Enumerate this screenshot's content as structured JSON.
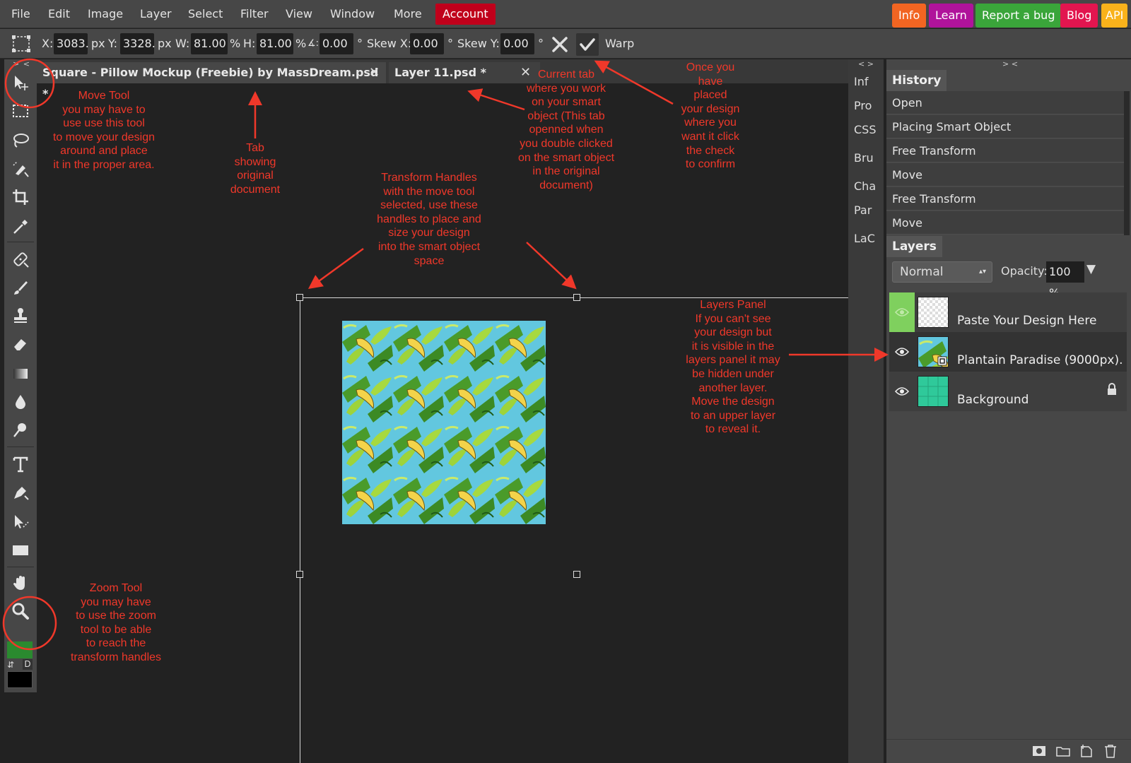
{
  "menu": {
    "items": [
      "File",
      "Edit",
      "Image",
      "Layer",
      "Select",
      "Filter",
      "View",
      "Window",
      "More"
    ],
    "account": "Account",
    "external": [
      "Info",
      "Learn",
      "Report a bug",
      "Blog",
      "API"
    ]
  },
  "options": {
    "x_label": "X:",
    "x_value": "3083.",
    "x_unit": "px",
    "y_label": "Y:",
    "y_value": "3328.",
    "y_unit": "px",
    "w_label": "W:",
    "w_value": "81.00",
    "w_unit": "%",
    "h_label": "H:",
    "h_value": "81.00",
    "h_unit": "%",
    "angle_label": "∡:",
    "angle_value": "0.00",
    "angle_unit": "°",
    "skewx_label": "Skew X:",
    "skewx_value": "0.00",
    "skewx_unit": "°",
    "skewy_label": "Skew Y:",
    "skewy_value": "0.00",
    "skewy_unit": "°",
    "warp_label": "Warp"
  },
  "toolbar": {
    "collapse": "> <",
    "swap": "⇵",
    "default_colors": "D",
    "fg_color": "#2a8a2f",
    "bg_color": "#000000"
  },
  "tabs": [
    {
      "label": "Square - Pillow Mockup (Freebie) by MassDream.psd *",
      "close": "✕"
    },
    {
      "label": "Layer 11.psd *",
      "close": "✕"
    }
  ],
  "mini_panel": {
    "toggle": "< >",
    "items": [
      "Inf",
      "Pro",
      "CSS",
      "Bru",
      "Cha",
      "Par",
      "LaC"
    ]
  },
  "right_panel": {
    "toggle": "> <",
    "history_title": "History",
    "history": [
      "Open",
      "Placing Smart Object",
      "Free Transform",
      "Move",
      "Free Transform",
      "Move"
    ],
    "layers_title": "Layers",
    "blend_mode": "Normal",
    "opacity_label": "Opacity:",
    "opacity_value": "100 %",
    "layers": [
      {
        "name": "Paste Your Design Here"
      },
      {
        "name": "Plantain Paradise (9000px).psd"
      },
      {
        "name": "Background"
      }
    ]
  },
  "annotations": {
    "move_tool": "Move Tool\nyou may have to\nuse use this tool\nto move your design\naround and place\nit in the proper area.",
    "tab_original": "Tab\nshowing\noriginal\ndocument",
    "current_tab": "Current tab\nwhere you work\non your smart\nobject (This tab\nopenned when\nyou double clicked\non the smart object\nin the original\ndocument)",
    "confirm": "Once you\nhave\nplaced\nyour design\nwhere you\nwant it click\nthe check\nto confirm",
    "handles": "Transform Handles\nwith the move tool\nselected, use these\nhandles to place and\nsize your design\ninto the smart object\nspace",
    "layers_panel": "Layers Panel\nIf you can't see\nyour design but\nit is visible in the\nlayers panel it may\nbe hidden under\nanother layer.\nMove the design\nto an upper layer\nto reveal it.",
    "zoom_tool": "Zoom Tool\nyou may have\nto use the zoom\ntool to be able\nto reach the\ntransform handles"
  },
  "colors": {
    "annotation": "#f0382a",
    "account": "#c0001b",
    "info": "#f26522",
    "learn": "#b0139b",
    "report": "#3aa53a",
    "blog": "#e2154f",
    "api": "#f9b21b"
  }
}
